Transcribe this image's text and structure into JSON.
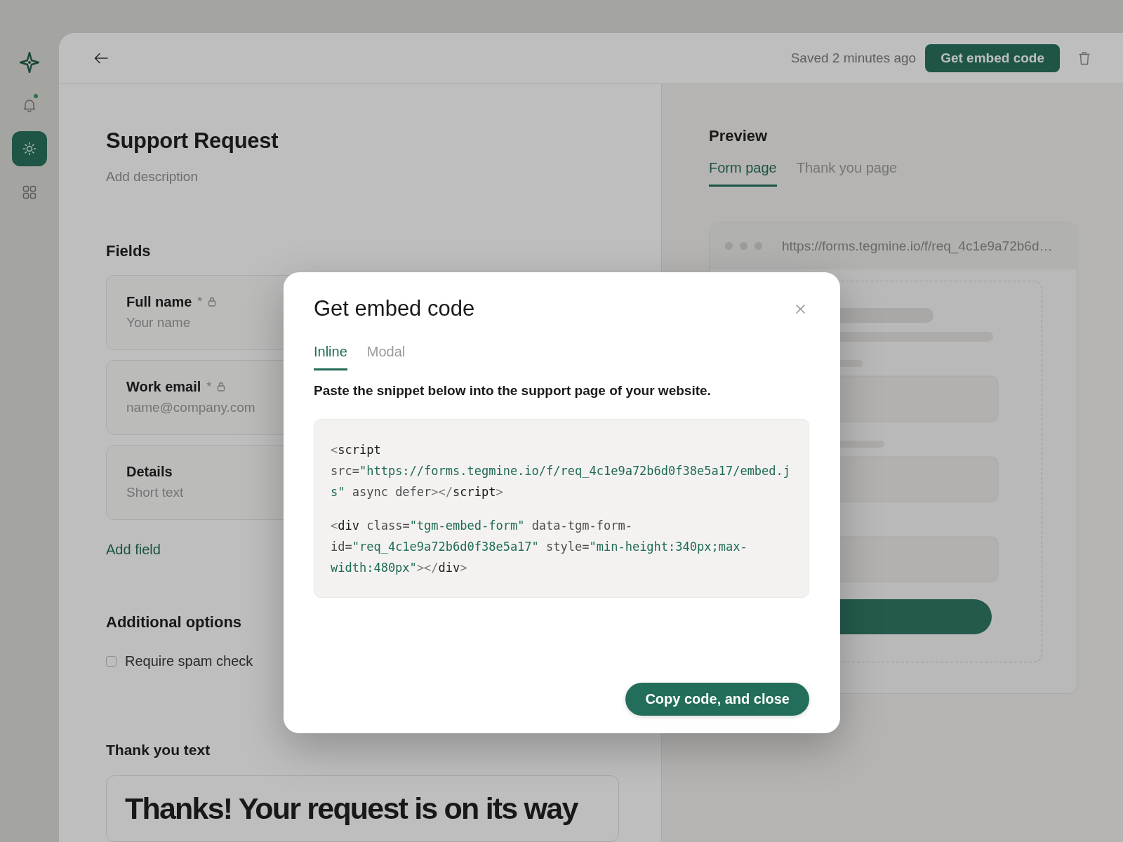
{
  "sidebar": {
    "nav_items": [
      {
        "kind": "bell",
        "selected": false,
        "notification": true
      },
      {
        "kind": "sun",
        "selected": true,
        "notification": false
      },
      {
        "kind": "grid",
        "selected": false,
        "notification": false
      }
    ]
  },
  "header": {
    "status": "Saved 2 minutes ago",
    "primary_button": "Get embed code"
  },
  "form": {
    "title": "Support Request",
    "description": {
      "placeholder": "Add description"
    },
    "fields_heading": "Fields",
    "fields": [
      {
        "label": "Full name",
        "required_mark": "*",
        "locked": true,
        "placeholder": "Your name"
      },
      {
        "label": "Work email",
        "required_mark": "*",
        "locked": true,
        "placeholder": "name@company.com"
      },
      {
        "label": "Details",
        "locked": false,
        "placeholder": "Short text"
      }
    ],
    "add_field": "Add field",
    "options_heading": "Additional options",
    "options": [
      {
        "label": "Require spam check",
        "checked": false
      }
    ],
    "thank_you_heading": "Thank you text",
    "thank_you_text": "Thanks! Your request is on its way"
  },
  "preview": {
    "heading": "Preview",
    "tabs": [
      {
        "label": "Form page",
        "selected": true
      },
      {
        "label": "Thank you page",
        "selected": false
      }
    ],
    "url": "https://forms.tegmine.io/f/req_4c1e9a72b6d…"
  },
  "modal": {
    "title": "Get embed code",
    "tabs": [
      {
        "label": "Inline",
        "selected": true
      },
      {
        "label": "Modal",
        "selected": false
      }
    ],
    "instruction": "Paste the snippet below into the support page of your website.",
    "snippets": [
      [
        {
          "text": "<",
          "kind": "punct"
        },
        {
          "text": "script",
          "kind": "tag"
        },
        {
          "text": " src=",
          "kind": "attr"
        },
        {
          "text": "\"https://forms.tegmine.io/f/req_4c1e9a72b6d0f38e5a17/embed.js\"",
          "kind": "string"
        },
        {
          "text": " async defer",
          "kind": "attr"
        },
        {
          "text": "></",
          "kind": "punct"
        },
        {
          "text": "script",
          "kind": "tag"
        },
        {
          "text": ">",
          "kind": "punct"
        }
      ],
      [
        {
          "text": "<",
          "kind": "punct"
        },
        {
          "text": "div",
          "kind": "tag"
        },
        {
          "text": " class=",
          "kind": "attr"
        },
        {
          "text": "\"tgm-embed-form\"",
          "kind": "string"
        },
        {
          "text": " data-tgm-form-id=",
          "kind": "attr"
        },
        {
          "text": "\"req_4c1e9a72b6d0f38e5a17\"",
          "kind": "string"
        },
        {
          "text": " style=",
          "kind": "attr"
        },
        {
          "text": "\"min-height:340px;max-width:480px\"",
          "kind": "string"
        },
        {
          "text": "></",
          "kind": "punct"
        },
        {
          "text": "div",
          "kind": "tag"
        },
        {
          "text": ">",
          "kind": "punct"
        }
      ]
    ],
    "confirm_button": "Copy code, and close"
  }
}
